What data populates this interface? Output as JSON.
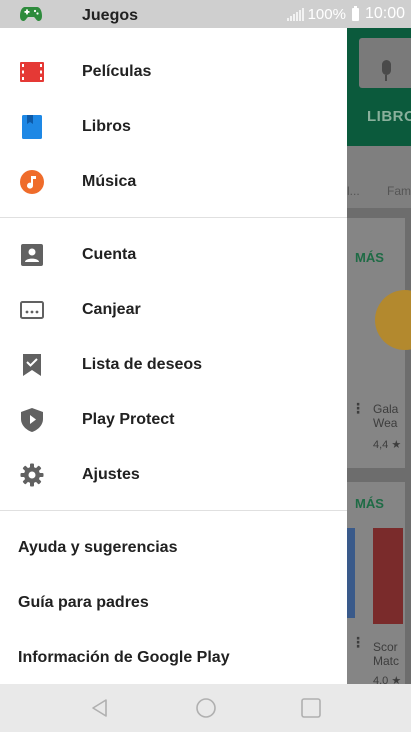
{
  "status_bar": {
    "battery_text": "100%",
    "time": "10:00"
  },
  "drawer": {
    "top_item": {
      "label": "Juegos",
      "icon": "gamepad-icon",
      "color": "#2e8b3c"
    },
    "media_items": [
      {
        "label": "Películas",
        "icon": "movie-film-icon",
        "color": "#e53935"
      },
      {
        "label": "Libros",
        "icon": "book-icon",
        "color": "#1e88e5"
      },
      {
        "label": "Música",
        "icon": "music-note-icon",
        "color": "#ef6c2b"
      }
    ],
    "account_items": [
      {
        "label": "Cuenta",
        "icon": "account-box-icon"
      },
      {
        "label": "Canjear",
        "icon": "redeem-card-icon"
      },
      {
        "label": "Lista de deseos",
        "icon": "wishlist-bookmark-icon"
      },
      {
        "label": "Play Protect",
        "icon": "shield-play-icon"
      },
      {
        "label": "Ajustes",
        "icon": "gear-icon"
      }
    ],
    "footer_items": [
      {
        "label": "Ayuda y sugerencias"
      },
      {
        "label": "Guía para padres"
      },
      {
        "label": "Información de Google Play"
      }
    ]
  },
  "background_app": {
    "tab_label": "LIBRO",
    "category_left": "l...",
    "category_right": "Fam",
    "section_more_1": "MÁS",
    "section_more_2": "MÁS",
    "card_1_title": "Gala",
    "card_1_sub": "Wea",
    "card_1_rating": "4,4 ★",
    "card_2_title": "Scor",
    "card_2_sub": "Matc",
    "card_2_rating": "4,0 ★"
  },
  "nav_bar": {
    "back": "back-triangle-icon",
    "home": "home-circle-icon",
    "recents": "recents-square-icon"
  }
}
